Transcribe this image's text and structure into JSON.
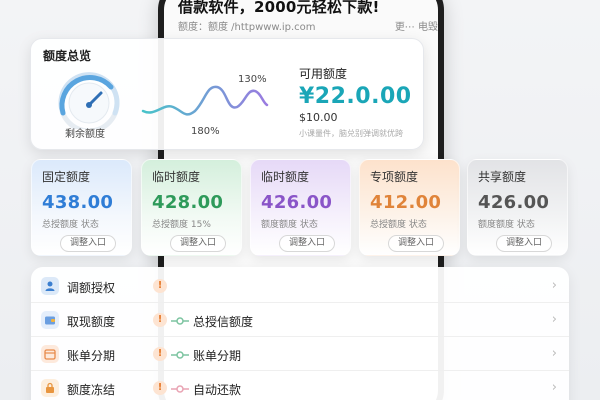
{
  "phone": {
    "title": "借款软件，2000元轻松下款!",
    "subtitle": "额度：额度 /httpwww.ip.com",
    "more": "更⋯  电毁"
  },
  "overview": {
    "title": "额度总览",
    "gauge_label": "剩余额度",
    "wave_pct_top": "130%",
    "wave_pct_bottom": "180%",
    "available_label": "可用额度",
    "available_amount": "¥22.0.00",
    "available_sub": "$10.00",
    "available_note": "小课量件，脑兑别弹调就优跨"
  },
  "quota_cards": [
    {
      "title": "固定额度",
      "value": "438.00",
      "sub": "总授额度 状态",
      "button": "调整入口"
    },
    {
      "title": "临时额度",
      "value": "428.00",
      "sub": "总授额度 15%",
      "button": "调整入口"
    },
    {
      "title": "临时额度",
      "value": "426.00",
      "sub": "额度额度 状态",
      "button": "调整入口"
    },
    {
      "title": "专项额度",
      "value": "412.00",
      "sub": "总授额度 状态",
      "button": "调整入口"
    },
    {
      "title": "共享额度",
      "value": "426.00",
      "sub": "额度额度 状态",
      "button": "调整入口"
    }
  ],
  "list": [
    {
      "icon": "user-icon",
      "label": "调额授权",
      "warn": "!",
      "sub": ""
    },
    {
      "icon": "wallet-icon",
      "label": "取现额度",
      "warn": "!",
      "sub": "总授信额度"
    },
    {
      "icon": "calendar-icon",
      "label": "账单分期",
      "warn": "!",
      "sub": "账单分期"
    },
    {
      "icon": "lock-icon",
      "label": "额度冻结",
      "warn": "!",
      "sub": "自动还款"
    }
  ],
  "colors": {
    "accent_teal": "#1aa6b7",
    "blue": "#2f7dd6",
    "green": "#2e9a5a",
    "purple": "#8a55c8",
    "orange": "#e0843a",
    "gray": "#555555"
  }
}
